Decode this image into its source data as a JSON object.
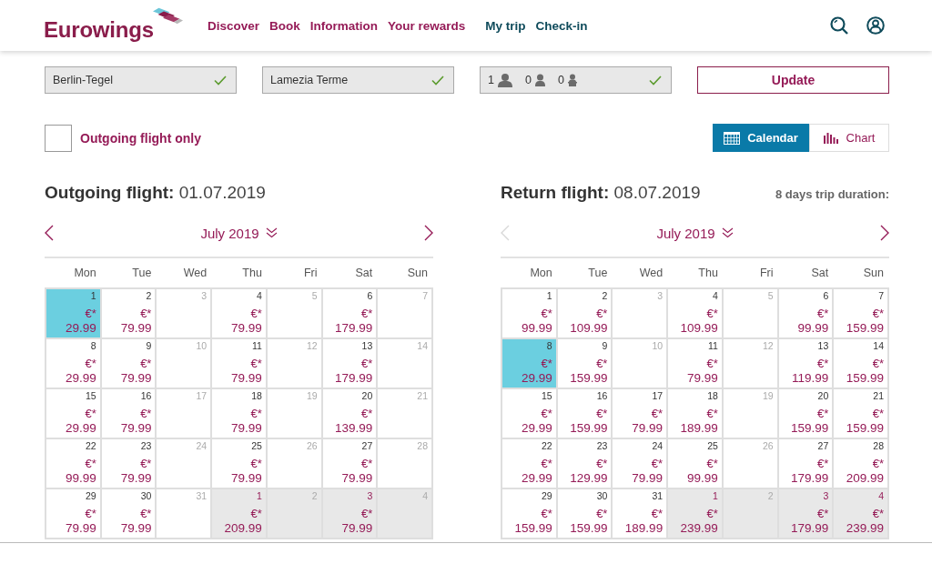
{
  "header": {
    "logo": "Eurowings",
    "nav_primary": [
      "Discover",
      "Book",
      "Information",
      "Your rewards"
    ],
    "nav_secondary": [
      "My trip",
      "Check-in"
    ]
  },
  "search": {
    "fields": [
      {
        "kind": "text",
        "value": "Berlin-Tegel",
        "valid": true
      },
      {
        "kind": "text",
        "value": "Lamezia Terme",
        "valid": true
      },
      {
        "kind": "passengers",
        "valid": true,
        "passengers": [
          {
            "kind": "adult",
            "count": "1"
          },
          {
            "kind": "child",
            "count": "0"
          },
          {
            "kind": "infant",
            "count": "0"
          }
        ]
      }
    ],
    "button": "Update"
  },
  "options": {
    "outgoing_only": {
      "label": "Outgoing flight only",
      "checked": false
    },
    "views": [
      {
        "kind": "calendar",
        "label": "Calendar",
        "selected": true
      },
      {
        "kind": "chart",
        "label": "Chart",
        "selected": false
      }
    ]
  },
  "calendars": [
    {
      "title": "**Outgoing flight:** 01.07.2019",
      "month": "July 2019",
      "prev_disabled": false,
      "next_disabled": false,
      "weekdays": [
        "Mon",
        "Tue",
        "Wed",
        "Thu",
        "Fri",
        "Sat",
        "Sun"
      ],
      "weeks": [
        [
          {
            "day": "1",
            "currency": "€*",
            "price": "29.99",
            "selected": true,
            "disabled": false,
            "other_month": false
          },
          {
            "day": "2",
            "currency": "€*",
            "price": "79.99",
            "selected": false,
            "disabled": false,
            "other_month": false
          },
          {
            "day": "3",
            "selected": false,
            "disabled": true,
            "other_month": false
          },
          {
            "day": "4",
            "currency": "€*",
            "price": "79.99",
            "selected": false,
            "disabled": false,
            "other_month": false
          },
          {
            "day": "5",
            "selected": false,
            "disabled": true,
            "other_month": false
          },
          {
            "day": "6",
            "currency": "€*",
            "price": "179.99",
            "selected": false,
            "disabled": false,
            "other_month": false
          },
          {
            "day": "7",
            "selected": false,
            "disabled": true,
            "other_month": false
          }
        ],
        [
          {
            "day": "8",
            "currency": "€*",
            "price": "29.99",
            "selected": false,
            "disabled": false,
            "other_month": false
          },
          {
            "day": "9",
            "currency": "€*",
            "price": "79.99",
            "selected": false,
            "disabled": false,
            "other_month": false
          },
          {
            "day": "10",
            "selected": false,
            "disabled": true,
            "other_month": false
          },
          {
            "day": "11",
            "currency": "€*",
            "price": "79.99",
            "selected": false,
            "disabled": false,
            "other_month": false
          },
          {
            "day": "12",
            "selected": false,
            "disabled": true,
            "other_month": false
          },
          {
            "day": "13",
            "currency": "€*",
            "price": "179.99",
            "selected": false,
            "disabled": false,
            "other_month": false
          },
          {
            "day": "14",
            "selected": false,
            "disabled": true,
            "other_month": false
          }
        ],
        [
          {
            "day": "15",
            "currency": "€*",
            "price": "29.99",
            "selected": false,
            "disabled": false,
            "other_month": false
          },
          {
            "day": "16",
            "currency": "€*",
            "price": "79.99",
            "selected": false,
            "disabled": false,
            "other_month": false
          },
          {
            "day": "17",
            "selected": false,
            "disabled": true,
            "other_month": false
          },
          {
            "day": "18",
            "currency": "€*",
            "price": "79.99",
            "selected": false,
            "disabled": false,
            "other_month": false
          },
          {
            "day": "19",
            "selected": false,
            "disabled": true,
            "other_month": false
          },
          {
            "day": "20",
            "currency": "€*",
            "price": "139.99",
            "selected": false,
            "disabled": false,
            "other_month": false
          },
          {
            "day": "21",
            "selected": false,
            "disabled": true,
            "other_month": false
          }
        ],
        [
          {
            "day": "22",
            "currency": "€*",
            "price": "99.99",
            "selected": false,
            "disabled": false,
            "other_month": false
          },
          {
            "day": "23",
            "currency": "€*",
            "price": "79.99",
            "selected": false,
            "disabled": false,
            "other_month": false
          },
          {
            "day": "24",
            "selected": false,
            "disabled": true,
            "other_month": false
          },
          {
            "day": "25",
            "currency": "€*",
            "price": "79.99",
            "selected": false,
            "disabled": false,
            "other_month": false
          },
          {
            "day": "26",
            "selected": false,
            "disabled": true,
            "other_month": false
          },
          {
            "day": "27",
            "currency": "€*",
            "price": "79.99",
            "selected": false,
            "disabled": false,
            "other_month": false
          },
          {
            "day": "28",
            "selected": false,
            "disabled": true,
            "other_month": false
          }
        ],
        [
          {
            "day": "29",
            "currency": "€*",
            "price": "79.99",
            "selected": false,
            "disabled": false,
            "other_month": false
          },
          {
            "day": "30",
            "currency": "€*",
            "price": "79.99",
            "selected": false,
            "disabled": false,
            "other_month": false
          },
          {
            "day": "31",
            "selected": false,
            "disabled": true,
            "other_month": false
          },
          {
            "day": "1",
            "currency": "€*",
            "price": "209.99",
            "selected": false,
            "disabled": false,
            "other_month": true
          },
          {
            "day": "2",
            "selected": false,
            "disabled": true,
            "other_month": true
          },
          {
            "day": "3",
            "currency": "€*",
            "price": "79.99",
            "selected": false,
            "disabled": false,
            "other_month": true
          },
          {
            "day": "4",
            "selected": false,
            "disabled": true,
            "other_month": true
          }
        ]
      ]
    },
    {
      "title": "**Return flight:** 08.07.2019",
      "note": "8 days trip duration:",
      "month": "July 2019",
      "prev_disabled": true,
      "next_disabled": false,
      "weekdays": [
        "Mon",
        "Tue",
        "Wed",
        "Thu",
        "Fri",
        "Sat",
        "Sun"
      ],
      "weeks": [
        [
          {
            "day": "1",
            "currency": "€*",
            "price": "99.99",
            "selected": false,
            "disabled": false,
            "other_month": false
          },
          {
            "day": "2",
            "currency": "€*",
            "price": "109.99",
            "selected": false,
            "disabled": false,
            "other_month": false
          },
          {
            "day": "3",
            "selected": false,
            "disabled": true,
            "other_month": false
          },
          {
            "day": "4",
            "currency": "€*",
            "price": "109.99",
            "selected": false,
            "disabled": false,
            "other_month": false
          },
          {
            "day": "5",
            "selected": false,
            "disabled": true,
            "other_month": false
          },
          {
            "day": "6",
            "currency": "€*",
            "price": "99.99",
            "selected": false,
            "disabled": false,
            "other_month": false
          },
          {
            "day": "7",
            "currency": "€*",
            "price": "159.99",
            "selected": false,
            "disabled": false,
            "other_month": false
          }
        ],
        [
          {
            "day": "8",
            "currency": "€*",
            "price": "29.99",
            "selected": true,
            "disabled": false,
            "other_month": false
          },
          {
            "day": "9",
            "currency": "€*",
            "price": "159.99",
            "selected": false,
            "disabled": false,
            "other_month": false
          },
          {
            "day": "10",
            "selected": false,
            "disabled": true,
            "other_month": false
          },
          {
            "day": "11",
            "currency": "€*",
            "price": "79.99",
            "selected": false,
            "disabled": false,
            "other_month": false
          },
          {
            "day": "12",
            "selected": false,
            "disabled": true,
            "other_month": false
          },
          {
            "day": "13",
            "currency": "€*",
            "price": "119.99",
            "selected": false,
            "disabled": false,
            "other_month": false
          },
          {
            "day": "14",
            "currency": "€*",
            "price": "159.99",
            "selected": false,
            "disabled": false,
            "other_month": false
          }
        ],
        [
          {
            "day": "15",
            "currency": "€*",
            "price": "29.99",
            "selected": false,
            "disabled": false,
            "other_month": false
          },
          {
            "day": "16",
            "currency": "€*",
            "price": "159.99",
            "selected": false,
            "disabled": false,
            "other_month": false
          },
          {
            "day": "17",
            "currency": "€*",
            "price": "79.99",
            "selected": false,
            "disabled": false,
            "other_month": false
          },
          {
            "day": "18",
            "currency": "€*",
            "price": "189.99",
            "selected": false,
            "disabled": false,
            "other_month": false
          },
          {
            "day": "19",
            "selected": false,
            "disabled": true,
            "other_month": false
          },
          {
            "day": "20",
            "currency": "€*",
            "price": "159.99",
            "selected": false,
            "disabled": false,
            "other_month": false
          },
          {
            "day": "21",
            "currency": "€*",
            "price": "159.99",
            "selected": false,
            "disabled": false,
            "other_month": false
          }
        ],
        [
          {
            "day": "22",
            "currency": "€*",
            "price": "29.99",
            "selected": false,
            "disabled": false,
            "other_month": false
          },
          {
            "day": "23",
            "currency": "€*",
            "price": "129.99",
            "selected": false,
            "disabled": false,
            "other_month": false
          },
          {
            "day": "24",
            "currency": "€*",
            "price": "79.99",
            "selected": false,
            "disabled": false,
            "other_month": false
          },
          {
            "day": "25",
            "currency": "€*",
            "price": "99.99",
            "selected": false,
            "disabled": false,
            "other_month": false
          },
          {
            "day": "26",
            "selected": false,
            "disabled": true,
            "other_month": false
          },
          {
            "day": "27",
            "currency": "€*",
            "price": "179.99",
            "selected": false,
            "disabled": false,
            "other_month": false
          },
          {
            "day": "28",
            "currency": "€*",
            "price": "209.99",
            "selected": false,
            "disabled": false,
            "other_month": false
          }
        ],
        [
          {
            "day": "29",
            "currency": "€*",
            "price": "159.99",
            "selected": false,
            "disabled": false,
            "other_month": false
          },
          {
            "day": "30",
            "currency": "€*",
            "price": "159.99",
            "selected": false,
            "disabled": false,
            "other_month": false
          },
          {
            "day": "31",
            "currency": "€*",
            "price": "189.99",
            "selected": false,
            "disabled": false,
            "other_month": false
          },
          {
            "day": "1",
            "currency": "€*",
            "price": "239.99",
            "selected": false,
            "disabled": false,
            "other_month": true
          },
          {
            "day": "2",
            "selected": false,
            "disabled": true,
            "other_month": true
          },
          {
            "day": "3",
            "currency": "€*",
            "price": "179.99",
            "selected": false,
            "disabled": false,
            "other_month": true
          },
          {
            "day": "4",
            "currency": "€*",
            "price": "239.99",
            "selected": false,
            "disabled": false,
            "other_month": true
          }
        ]
      ]
    }
  ]
}
